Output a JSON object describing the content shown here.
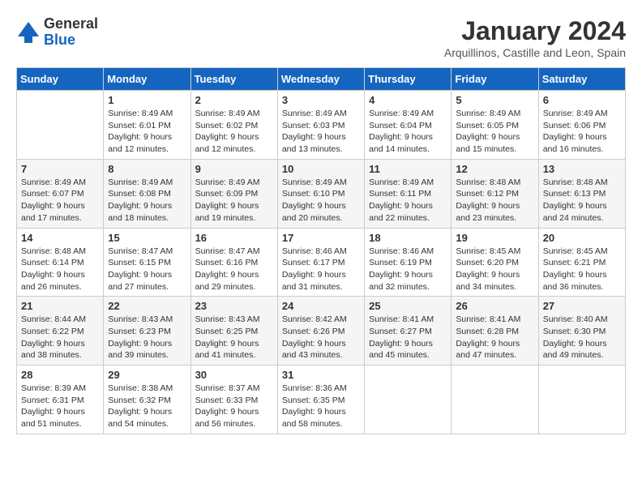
{
  "header": {
    "logo_line1": "General",
    "logo_line2": "Blue",
    "month_title": "January 2024",
    "subtitle": "Arquillinos, Castille and Leon, Spain"
  },
  "weekdays": [
    "Sunday",
    "Monday",
    "Tuesday",
    "Wednesday",
    "Thursday",
    "Friday",
    "Saturday"
  ],
  "weeks": [
    [
      {
        "day": "",
        "info": ""
      },
      {
        "day": "1",
        "info": "Sunrise: 8:49 AM\nSunset: 6:01 PM\nDaylight: 9 hours\nand 12 minutes."
      },
      {
        "day": "2",
        "info": "Sunrise: 8:49 AM\nSunset: 6:02 PM\nDaylight: 9 hours\nand 12 minutes."
      },
      {
        "day": "3",
        "info": "Sunrise: 8:49 AM\nSunset: 6:03 PM\nDaylight: 9 hours\nand 13 minutes."
      },
      {
        "day": "4",
        "info": "Sunrise: 8:49 AM\nSunset: 6:04 PM\nDaylight: 9 hours\nand 14 minutes."
      },
      {
        "day": "5",
        "info": "Sunrise: 8:49 AM\nSunset: 6:05 PM\nDaylight: 9 hours\nand 15 minutes."
      },
      {
        "day": "6",
        "info": "Sunrise: 8:49 AM\nSunset: 6:06 PM\nDaylight: 9 hours\nand 16 minutes."
      }
    ],
    [
      {
        "day": "7",
        "info": "Sunrise: 8:49 AM\nSunset: 6:07 PM\nDaylight: 9 hours\nand 17 minutes."
      },
      {
        "day": "8",
        "info": "Sunrise: 8:49 AM\nSunset: 6:08 PM\nDaylight: 9 hours\nand 18 minutes."
      },
      {
        "day": "9",
        "info": "Sunrise: 8:49 AM\nSunset: 6:09 PM\nDaylight: 9 hours\nand 19 minutes."
      },
      {
        "day": "10",
        "info": "Sunrise: 8:49 AM\nSunset: 6:10 PM\nDaylight: 9 hours\nand 20 minutes."
      },
      {
        "day": "11",
        "info": "Sunrise: 8:49 AM\nSunset: 6:11 PM\nDaylight: 9 hours\nand 22 minutes."
      },
      {
        "day": "12",
        "info": "Sunrise: 8:48 AM\nSunset: 6:12 PM\nDaylight: 9 hours\nand 23 minutes."
      },
      {
        "day": "13",
        "info": "Sunrise: 8:48 AM\nSunset: 6:13 PM\nDaylight: 9 hours\nand 24 minutes."
      }
    ],
    [
      {
        "day": "14",
        "info": "Sunrise: 8:48 AM\nSunset: 6:14 PM\nDaylight: 9 hours\nand 26 minutes."
      },
      {
        "day": "15",
        "info": "Sunrise: 8:47 AM\nSunset: 6:15 PM\nDaylight: 9 hours\nand 27 minutes."
      },
      {
        "day": "16",
        "info": "Sunrise: 8:47 AM\nSunset: 6:16 PM\nDaylight: 9 hours\nand 29 minutes."
      },
      {
        "day": "17",
        "info": "Sunrise: 8:46 AM\nSunset: 6:17 PM\nDaylight: 9 hours\nand 31 minutes."
      },
      {
        "day": "18",
        "info": "Sunrise: 8:46 AM\nSunset: 6:19 PM\nDaylight: 9 hours\nand 32 minutes."
      },
      {
        "day": "19",
        "info": "Sunrise: 8:45 AM\nSunset: 6:20 PM\nDaylight: 9 hours\nand 34 minutes."
      },
      {
        "day": "20",
        "info": "Sunrise: 8:45 AM\nSunset: 6:21 PM\nDaylight: 9 hours\nand 36 minutes."
      }
    ],
    [
      {
        "day": "21",
        "info": "Sunrise: 8:44 AM\nSunset: 6:22 PM\nDaylight: 9 hours\nand 38 minutes."
      },
      {
        "day": "22",
        "info": "Sunrise: 8:43 AM\nSunset: 6:23 PM\nDaylight: 9 hours\nand 39 minutes."
      },
      {
        "day": "23",
        "info": "Sunrise: 8:43 AM\nSunset: 6:25 PM\nDaylight: 9 hours\nand 41 minutes."
      },
      {
        "day": "24",
        "info": "Sunrise: 8:42 AM\nSunset: 6:26 PM\nDaylight: 9 hours\nand 43 minutes."
      },
      {
        "day": "25",
        "info": "Sunrise: 8:41 AM\nSunset: 6:27 PM\nDaylight: 9 hours\nand 45 minutes."
      },
      {
        "day": "26",
        "info": "Sunrise: 8:41 AM\nSunset: 6:28 PM\nDaylight: 9 hours\nand 47 minutes."
      },
      {
        "day": "27",
        "info": "Sunrise: 8:40 AM\nSunset: 6:30 PM\nDaylight: 9 hours\nand 49 minutes."
      }
    ],
    [
      {
        "day": "28",
        "info": "Sunrise: 8:39 AM\nSunset: 6:31 PM\nDaylight: 9 hours\nand 51 minutes."
      },
      {
        "day": "29",
        "info": "Sunrise: 8:38 AM\nSunset: 6:32 PM\nDaylight: 9 hours\nand 54 minutes."
      },
      {
        "day": "30",
        "info": "Sunrise: 8:37 AM\nSunset: 6:33 PM\nDaylight: 9 hours\nand 56 minutes."
      },
      {
        "day": "31",
        "info": "Sunrise: 8:36 AM\nSunset: 6:35 PM\nDaylight: 9 hours\nand 58 minutes."
      },
      {
        "day": "",
        "info": ""
      },
      {
        "day": "",
        "info": ""
      },
      {
        "day": "",
        "info": ""
      }
    ]
  ]
}
